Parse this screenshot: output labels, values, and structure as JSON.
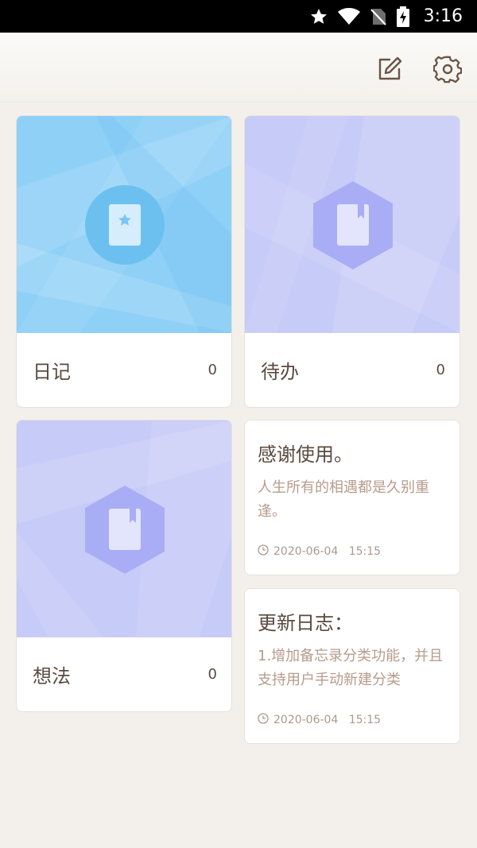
{
  "status_bar": {
    "time": "3:16",
    "icons": [
      "star-icon",
      "wifi-icon",
      "no-sim-icon",
      "battery-charging-icon"
    ]
  },
  "toolbar": {
    "icons": [
      "edit-icon",
      "settings-gear-icon"
    ]
  },
  "categories": [
    {
      "title": "日记",
      "count": "0",
      "icon": "star-book-icon",
      "color": "#8fd0f7"
    },
    {
      "title": "待办",
      "count": "0",
      "icon": "bookmark-book-icon",
      "color": "#c7cbf8"
    },
    {
      "title": "想法",
      "count": "0",
      "icon": "bookmark-book-icon",
      "color": "#c7cbf8"
    }
  ],
  "notes": [
    {
      "title": "感谢使用。",
      "body": "人生所有的相遇都是久别重逢。",
      "date": "2020-06-04   15:15",
      "icon": "clock-icon"
    },
    {
      "title": "更新日志：",
      "body": "1.增加备忘录分类功能，并且支持用户手动新建分类",
      "date": "2020-06-04   15:15",
      "icon": "clock-icon"
    }
  ],
  "colors": {
    "background": "#f3f0ec",
    "text_primary": "#5b4a40",
    "text_secondary": "#b79c8c",
    "blue_card": "#8fd0f7",
    "lavender_card": "#c7cbf8"
  }
}
